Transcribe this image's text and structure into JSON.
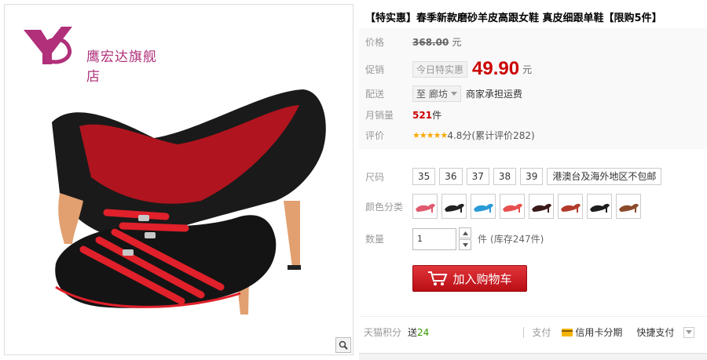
{
  "store": {
    "logo_glyph": "YD",
    "name": "鹰宏达旗舰店",
    "brand_color": "#b0307a"
  },
  "product": {
    "title": "【特实惠】春季新款磨砂羊皮高跟女鞋 真皮细跟单鞋【限购5件】"
  },
  "price": {
    "label": "价格",
    "original": "368.00",
    "unit": "元"
  },
  "promo": {
    "label": "促销",
    "tag": "今日特实惠",
    "price": "49.90",
    "unit": "元",
    "price_color": "#cc0000"
  },
  "delivery": {
    "label": "配送",
    "prefix": "至",
    "location": "廊坊",
    "note": "商家承担运费"
  },
  "monthly_sales": {
    "label": "月销量",
    "count": "521",
    "unit": "件"
  },
  "rating": {
    "label": "评价",
    "stars": "★★★★★",
    "text": "4.8分(累计评价282)",
    "stars_value": 4.8
  },
  "sizes": {
    "label": "尺码",
    "options": [
      "35",
      "36",
      "37",
      "38",
      "39",
      "港澳台及海外地区不包邮"
    ]
  },
  "colors": {
    "label": "颜色分类",
    "swatches": [
      {
        "name": "pink",
        "color": "#e05a6e"
      },
      {
        "name": "black",
        "color": "#222222"
      },
      {
        "name": "blue",
        "color": "#2a9ad6"
      },
      {
        "name": "coral",
        "color": "#e8504f"
      },
      {
        "name": "black-red",
        "color": "#3a1a1a"
      },
      {
        "name": "red-brown",
        "color": "#b23a2a"
      },
      {
        "name": "black-red-2",
        "color": "#1e1e1e"
      },
      {
        "name": "brown",
        "color": "#8a4a2a"
      }
    ]
  },
  "quantity": {
    "label": "数量",
    "value": "1",
    "unit": "件",
    "stock": "(库存247件)"
  },
  "cart": {
    "label": "加入购物车",
    "color": "#c8161d"
  },
  "footer": {
    "points_label": "天猫积分",
    "points_prefix": "送",
    "points_value": "24",
    "pay_label": "支付",
    "credit_label": "信用卡分期",
    "quick_pay": "快捷支付"
  }
}
